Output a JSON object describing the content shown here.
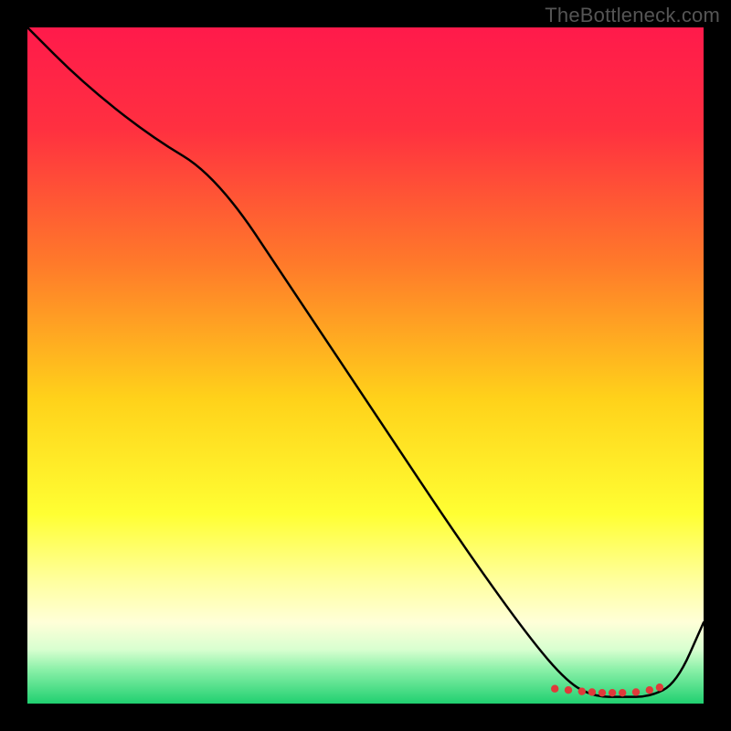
{
  "watermark": "TheBottleneck.com",
  "chart_data": {
    "type": "line",
    "title": "",
    "xlabel": "",
    "ylabel": "",
    "xlim": [
      0,
      100
    ],
    "ylim": [
      0,
      100
    ],
    "background_gradient_stops": [
      {
        "offset": 0.0,
        "color": "#ff1a4b"
      },
      {
        "offset": 0.15,
        "color": "#ff3040"
      },
      {
        "offset": 0.35,
        "color": "#ff7a2a"
      },
      {
        "offset": 0.55,
        "color": "#ffd21a"
      },
      {
        "offset": 0.72,
        "color": "#ffff33"
      },
      {
        "offset": 0.82,
        "color": "#ffffa0"
      },
      {
        "offset": 0.88,
        "color": "#ffffd8"
      },
      {
        "offset": 0.92,
        "color": "#d8ffd0"
      },
      {
        "offset": 0.95,
        "color": "#8af0a8"
      },
      {
        "offset": 1.0,
        "color": "#20d070"
      }
    ],
    "series": [
      {
        "name": "bottleneck-curve",
        "x": [
          0,
          8,
          18,
          28,
          40,
          52,
          64,
          74,
          80,
          84,
          88,
          92,
          96,
          100
        ],
        "y": [
          100,
          92,
          84,
          78,
          60,
          42,
          24,
          10,
          3,
          1,
          1,
          1,
          3,
          12
        ]
      }
    ],
    "markers": {
      "name": "optimal-range-markers",
      "color": "#e03a3a",
      "points": [
        {
          "x": 78,
          "y": 2.2
        },
        {
          "x": 80,
          "y": 2.0
        },
        {
          "x": 82,
          "y": 1.8
        },
        {
          "x": 83.5,
          "y": 1.7
        },
        {
          "x": 85,
          "y": 1.6
        },
        {
          "x": 86.5,
          "y": 1.6
        },
        {
          "x": 88,
          "y": 1.6
        },
        {
          "x": 90,
          "y": 1.7
        },
        {
          "x": 92,
          "y": 2.0
        },
        {
          "x": 93.5,
          "y": 2.4
        }
      ]
    }
  }
}
